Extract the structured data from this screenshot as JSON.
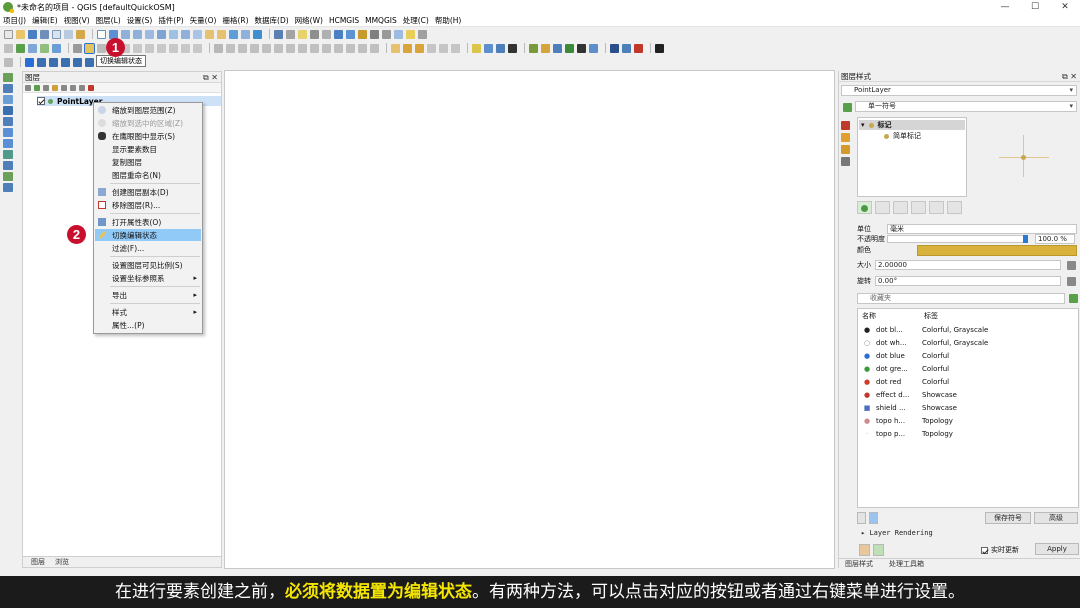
{
  "window": {
    "title": "*未命名的项目 - QGIS [defaultQuickOSM]",
    "controls": [
      "—",
      "☐",
      "✕"
    ]
  },
  "menu": [
    "项目(J)",
    "编辑(E)",
    "视图(V)",
    "图层(L)",
    "设置(S)",
    "插件(P)",
    "矢量(O)",
    "栅格(R)",
    "数据库(D)",
    "网络(W)",
    "HCMGIS",
    "MMQGIS",
    "处理(C)",
    "帮助(H)"
  ],
  "toolbar": {
    "tooltip": "切换编辑状态",
    "step1_badge": "1",
    "step2_badge": "2"
  },
  "layers_panel": {
    "title": "图层",
    "controls": "⧉ ✕",
    "layer_name": "PointLayer",
    "bottom_tabs": [
      "图层",
      "浏览"
    ]
  },
  "context_menu": {
    "items": [
      {
        "label": "缩放到图层范围(Z)",
        "disabled": false
      },
      {
        "label": "缩放到选中的区域(Z)",
        "disabled": true
      },
      {
        "label": "在鹰眼图中显示(S)",
        "disabled": false
      },
      {
        "label": "显示要素数目",
        "disabled": false
      },
      {
        "label": "复制图层",
        "disabled": false
      },
      {
        "label": "图层重命名(N)",
        "disabled": false
      },
      {
        "label": "创建图层副本(D)",
        "disabled": false
      },
      {
        "label": "移除图层(R)...",
        "disabled": false
      },
      {
        "label": "打开属性表(O)",
        "disabled": false
      },
      {
        "label": "切换编辑状态",
        "disabled": false,
        "highlighted": true
      },
      {
        "label": "过滤(F)...",
        "disabled": false
      },
      {
        "label": "设置图层可见比例(S)",
        "disabled": false
      },
      {
        "label": "设置坐标参照系",
        "disabled": false,
        "submenu": true
      },
      {
        "label": "导出",
        "disabled": false,
        "submenu": true
      },
      {
        "label": "样式",
        "disabled": false,
        "submenu": true
      },
      {
        "label": "属性...(P)",
        "disabled": false
      }
    ]
  },
  "style_panel": {
    "title": "图层样式",
    "controls": "⧉ ✕",
    "layer_select": "PointLayer",
    "renderer_select": "单一符号",
    "tree_root": "标记",
    "tree_child": "简单标记",
    "unit_label": "单位",
    "unit_value": "毫米",
    "opacity_label": "不透明度",
    "opacity_value": "100.0 %",
    "color_label": "颜色",
    "size_label": "大小",
    "size_value": "2.00000",
    "rotation_label": "旋转",
    "rotation_value": "0.00°",
    "search_placeholder": "收藏夹",
    "list_header_name": "名称",
    "list_header_tag": "标签",
    "symbols": [
      {
        "name": "dot bl...",
        "tags": "Colorful, Grayscale",
        "marker": "●",
        "color": "#222222"
      },
      {
        "name": "dot wh...",
        "tags": "Colorful, Grayscale",
        "marker": "○",
        "color": "#888888"
      },
      {
        "name": "dot blue",
        "tags": "Colorful",
        "marker": "●",
        "color": "#2b6fd6"
      },
      {
        "name": "dot gre...",
        "tags": "Colorful",
        "marker": "●",
        "color": "#3a9a3a"
      },
      {
        "name": "dot red",
        "tags": "Colorful",
        "marker": "●",
        "color": "#d23a2a"
      },
      {
        "name": "effect d...",
        "tags": "Showcase",
        "marker": "●",
        "color": "#c0392b"
      },
      {
        "name": "shield ...",
        "tags": "Showcase",
        "marker": "■",
        "color": "#4a6fc0"
      },
      {
        "name": "topo h...",
        "tags": "Topology",
        "marker": "●",
        "color": "#d08a8a"
      },
      {
        "name": "topo p...",
        "tags": "Topology",
        "marker": "·",
        "color": "#aaaaaa"
      }
    ],
    "save_symbol_btn": "保存符号",
    "advanced_btn": "高级",
    "layer_rendering": "Layer Rendering",
    "realtime_label": "实时更新",
    "apply_btn": "Apply",
    "bottom_tabs": [
      "图层样式",
      "处理工具箱"
    ]
  },
  "subtitle": {
    "part1": "在进行要素创建之前，",
    "highlight": "必须将数据置为编辑状态",
    "part2": "。有两种方法，可以点击对应的按钮或者通过右键菜单进行设置。"
  },
  "colors": {
    "accent_red": "#c8102e",
    "highlight_yellow": "#f4e600",
    "menu_highlight": "#91c9f7",
    "symbol_color": "#d8b23a"
  }
}
